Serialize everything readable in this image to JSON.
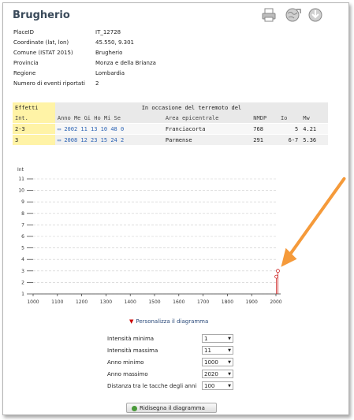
{
  "page": {
    "title": "Brugherio"
  },
  "toolbar": {
    "print_icon": "printer-icon",
    "globe_icon": "globe-export-icon",
    "download_icon": "download-icon"
  },
  "info": [
    {
      "k": "PlaceID",
      "v": "IT_12728"
    },
    {
      "k": "Coordinate (lat, lon)",
      "v": "45.550, 9.301"
    },
    {
      "k": "Comune (ISTAT 2015)",
      "v": "Brugherio"
    },
    {
      "k": "Provincia",
      "v": "Monza e della Brianza"
    },
    {
      "k": "Regione",
      "v": "Lombardia"
    },
    {
      "k": "Numero di eventi riportati",
      "v": "2"
    }
  ],
  "events": {
    "effects_label": "Effetti",
    "occasion_label": "In occasione del terremoto del",
    "columns": [
      "Int.",
      "Anno Me Gi Ho Mi Se",
      "Area epicentrale",
      "NMDP",
      "Io",
      "Mw"
    ],
    "rows": [
      {
        "int": "2-3",
        "date": "2002 11 13 10 48 0",
        "area": "Franciacorta",
        "nmdp": "768",
        "io": "5",
        "mw": "4.21"
      },
      {
        "int": "3",
        "date": "2008 12 23 15 24 2",
        "area": "Parmense",
        "nmdp": "291",
        "io": "6-7",
        "mw": "5.36"
      }
    ]
  },
  "chart_data": {
    "type": "scatter",
    "ylabel": "Int",
    "xlim": [
      1000,
      2000
    ],
    "ylim": [
      1,
      11
    ],
    "x_ticks": [
      1000,
      1100,
      1200,
      1300,
      1400,
      1500,
      1600,
      1700,
      1800,
      1900,
      2000
    ],
    "y_ticks": [
      1,
      2,
      3,
      4,
      5,
      6,
      7,
      8,
      9,
      10,
      11
    ],
    "points": [
      {
        "x": 2002,
        "y": 2.5
      },
      {
        "x": 2008,
        "y": 3
      }
    ],
    "grid": "horizontal dashed",
    "point_color": "#cc2222",
    "annotation": "orange arrow pointing to data points",
    "arrow_color": "#f59a3a"
  },
  "customize": {
    "label": "Personalizza il diagramma"
  },
  "form": [
    {
      "label": "Intensità minima",
      "value": "1"
    },
    {
      "label": "Intensità massima",
      "value": "11"
    },
    {
      "label": "Anno minimo",
      "value": "1000"
    },
    {
      "label": "Anno massimo",
      "value": "2020"
    },
    {
      "label": "Distanza tra le tacche degli anni",
      "value": "100"
    }
  ],
  "redraw_button": {
    "label": "Ridisegna il diagramma"
  }
}
